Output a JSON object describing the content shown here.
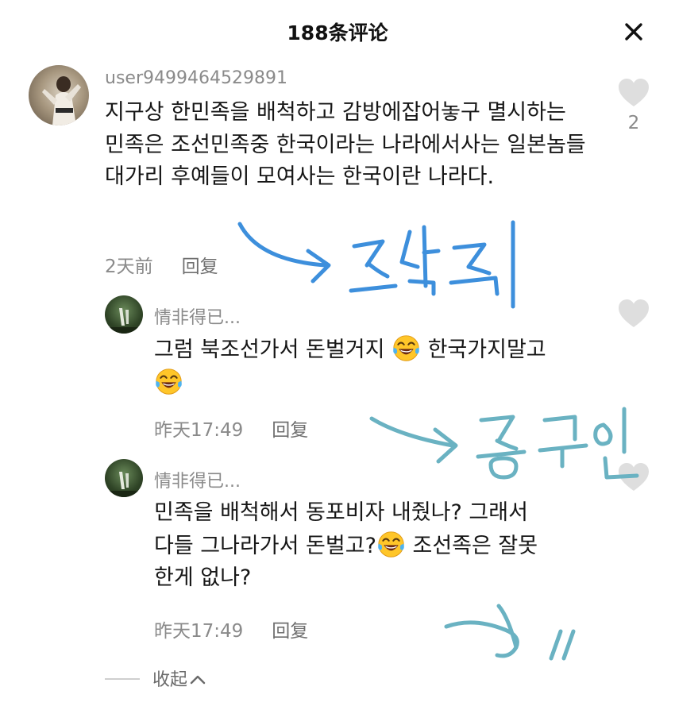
{
  "header": {
    "title": "188条评论"
  },
  "comment": {
    "username": "user9499464529891",
    "text": "지구상 한민족을 배척하고 감방에잡어놓구 멸시하는 민족은 조선민족중 한국이라는 나라에서사는 일본놈들대가리 후예들이 모여사는 한국이란 나라다.",
    "time": "2天前",
    "reply_label": "回复",
    "likes": "2"
  },
  "replies": [
    {
      "username": "情非得已...",
      "text_before": "그럼 북조선가서 돈벌거지 ",
      "text_middle": " 한국가지말고",
      "time": "昨天17:49",
      "reply_label": "回复"
    },
    {
      "username": "情非得已...",
      "text_line1": "민족을 배척해서 동포비자 내줬나? 그래서",
      "text_before": "다들 그나라가서 돈벌고?",
      "text_after": " 조선족은 잘못",
      "text_line3": "한게 없나?",
      "time": "昨天17:49",
      "reply_label": "回复"
    }
  ],
  "collapse_label": "收起",
  "icons": {
    "close": "close-icon",
    "like": "heart-icon",
    "emoji": "laughing-tears-emoji",
    "collapse": "chevron-up-icon"
  },
  "colors": {
    "annotation_blue": "#3d8fdc",
    "annotation_teal": "#6ab2c2",
    "muted_text": "#8a8a8a"
  }
}
